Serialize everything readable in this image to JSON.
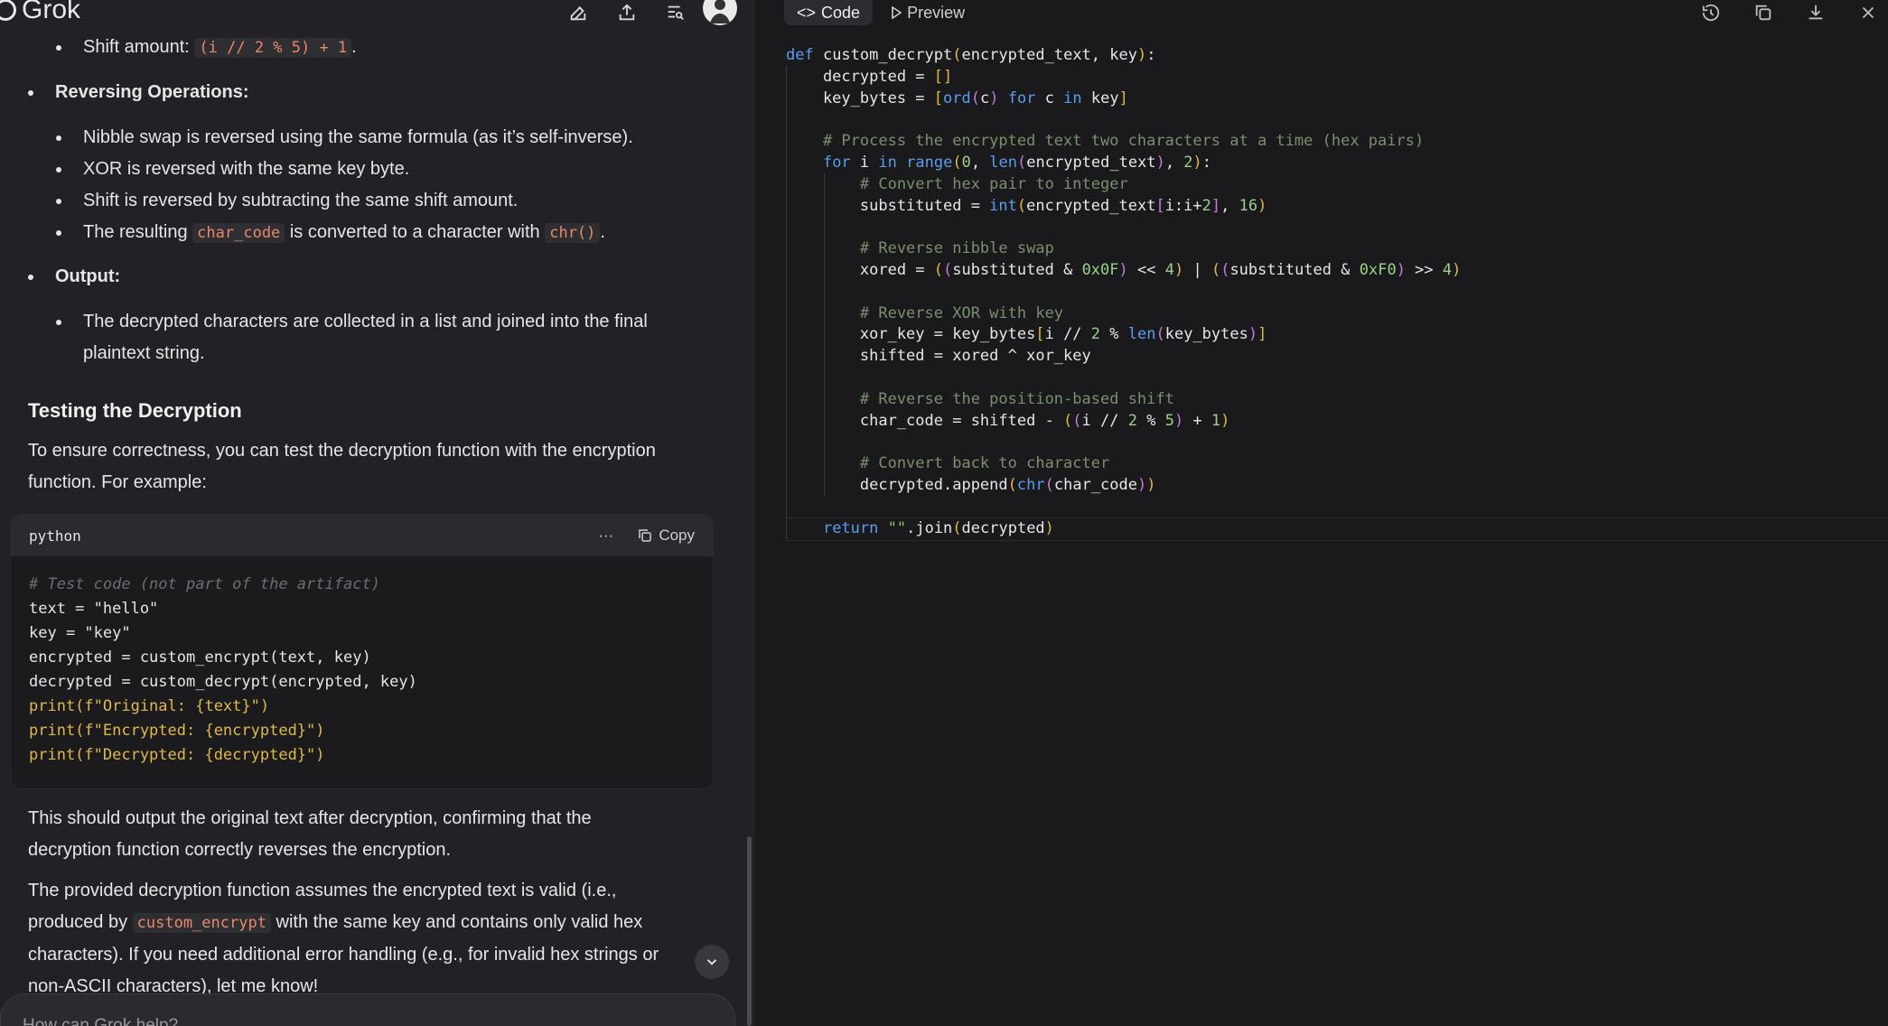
{
  "app": {
    "name": "Grok"
  },
  "left": {
    "bullet_top": {
      "label": "Shift amount: ",
      "code": "(i // 2 % 5) + 1",
      "suffix": "."
    },
    "reversing": {
      "title": "Reversing Operations:",
      "items": [
        "Nibble swap is reversed using the same formula (as it’s self-inverse).",
        "XOR is reversed with the same key byte.",
        "Shift is reversed by subtracting the same shift amount."
      ],
      "last_prefix": "The resulting ",
      "last_code1": "char_code",
      "last_mid": " is converted to a character with ",
      "last_code2": "chr()",
      "last_suffix": "."
    },
    "output": {
      "title": "Output:",
      "item_line1": "The decrypted characters are collected in a list and joined into the final",
      "item_line2": "plaintext string."
    },
    "testing_heading": "Testing the Decryption",
    "testing_para_line1": "To ensure correctness, you can test the decryption function with the encryption",
    "testing_para_line2": "function. For example:",
    "codeblock": {
      "lang": "python",
      "more": "···",
      "copy_label": "Copy",
      "lines": [
        "# Test code (not part of the artifact)",
        "text = \"hello\"",
        "key = \"key\"",
        "encrypted = custom_encrypt(text, key)",
        "decrypted = custom_decrypt(encrypted, key)",
        "print(f\"Original: {text}\")",
        "print(f\"Encrypted: {encrypted}\")",
        "print(f\"Decrypted: {decrypted}\")"
      ]
    },
    "para2_line1": "This should output the original text after decryption, confirming that the",
    "para2_line2": "decryption function correctly reverses the encryption.",
    "para3_line1": "The provided decryption function assumes the encrypted text is valid (i.e.,",
    "para3_line2_pre": "produced by ",
    "para3_line2_code": "custom_encrypt",
    "para3_line2_post": " with the same key and contains only valid hex",
    "para3_line3": "characters). If you need additional error handling (e.g., for invalid hex strings or",
    "para3_line4": "non-ASCII characters), let me know!",
    "input_placeholder": "How can Grok help?"
  },
  "right": {
    "tabs": [
      {
        "label": "Code",
        "icon": "code-icon"
      },
      {
        "label": "Preview",
        "icon": "play-icon"
      }
    ],
    "code_lines": [
      "def custom_decrypt(encrypted_text, key):",
      "    decrypted = []",
      "    key_bytes = [ord(c) for c in key]",
      "",
      "    # Process the encrypted text two characters at a time (hex pairs)",
      "    for i in range(0, len(encrypted_text), 2):",
      "        # Convert hex pair to integer",
      "        substituted = int(encrypted_text[i:i+2], 16)",
      "",
      "        # Reverse nibble swap",
      "        xored = ((substituted & 0x0F) << 4) | ((substituted & 0xF0) >> 4)",
      "",
      "        # Reverse XOR with key",
      "        xor_key = key_bytes[i // 2 % len(key_bytes)]",
      "        shifted = xored ^ xor_key",
      "",
      "        # Reverse the position-based shift",
      "        char_code = shifted - ((i // 2 % 5) + 1)",
      "",
      "        # Convert back to character",
      "        decrypted.append(chr(char_code))",
      "",
      "    return \"\".join(decrypted)"
    ]
  }
}
